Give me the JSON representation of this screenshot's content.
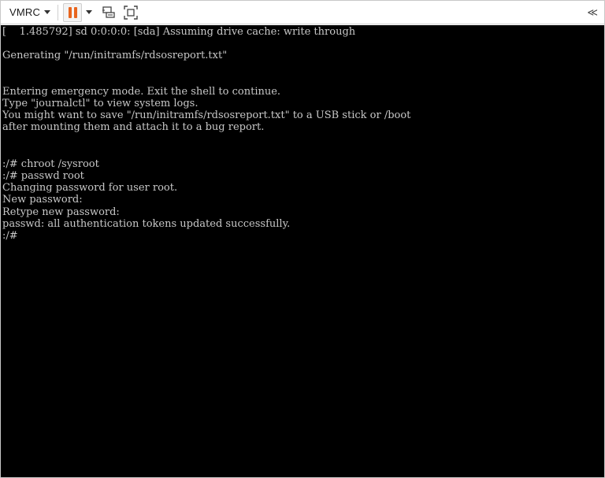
{
  "toolbar": {
    "vmrc_label": "VMRC",
    "collapse_glyph": "≪",
    "icons": [
      "chevron-down-icon",
      "pause-icon",
      "send-ctrl-alt-del-icon",
      "fullscreen-icon",
      "collapse-icon"
    ],
    "colors": {
      "pause": "#e8641d"
    }
  },
  "console": {
    "background": "#000000",
    "text_color": "#c8c8c8",
    "lines": [
      "[    1.485792] sd 0:0:0:0: [sda] Assuming drive cache: write through",
      "",
      "Generating \"/run/initramfs/rdsosreport.txt\"",
      "",
      "",
      "Entering emergency mode. Exit the shell to continue.",
      "Type \"journalctl\" to view system logs.",
      "You might want to save \"/run/initramfs/rdsosreport.txt\" to a USB stick or /boot",
      "after mounting them and attach it to a bug report.",
      "",
      "",
      ":/# chroot /sysroot",
      ":/# passwd root",
      "Changing password for user root.",
      "New password:",
      "Retype new password:",
      "passwd: all authentication tokens updated successfully.",
      ":/#"
    ]
  }
}
